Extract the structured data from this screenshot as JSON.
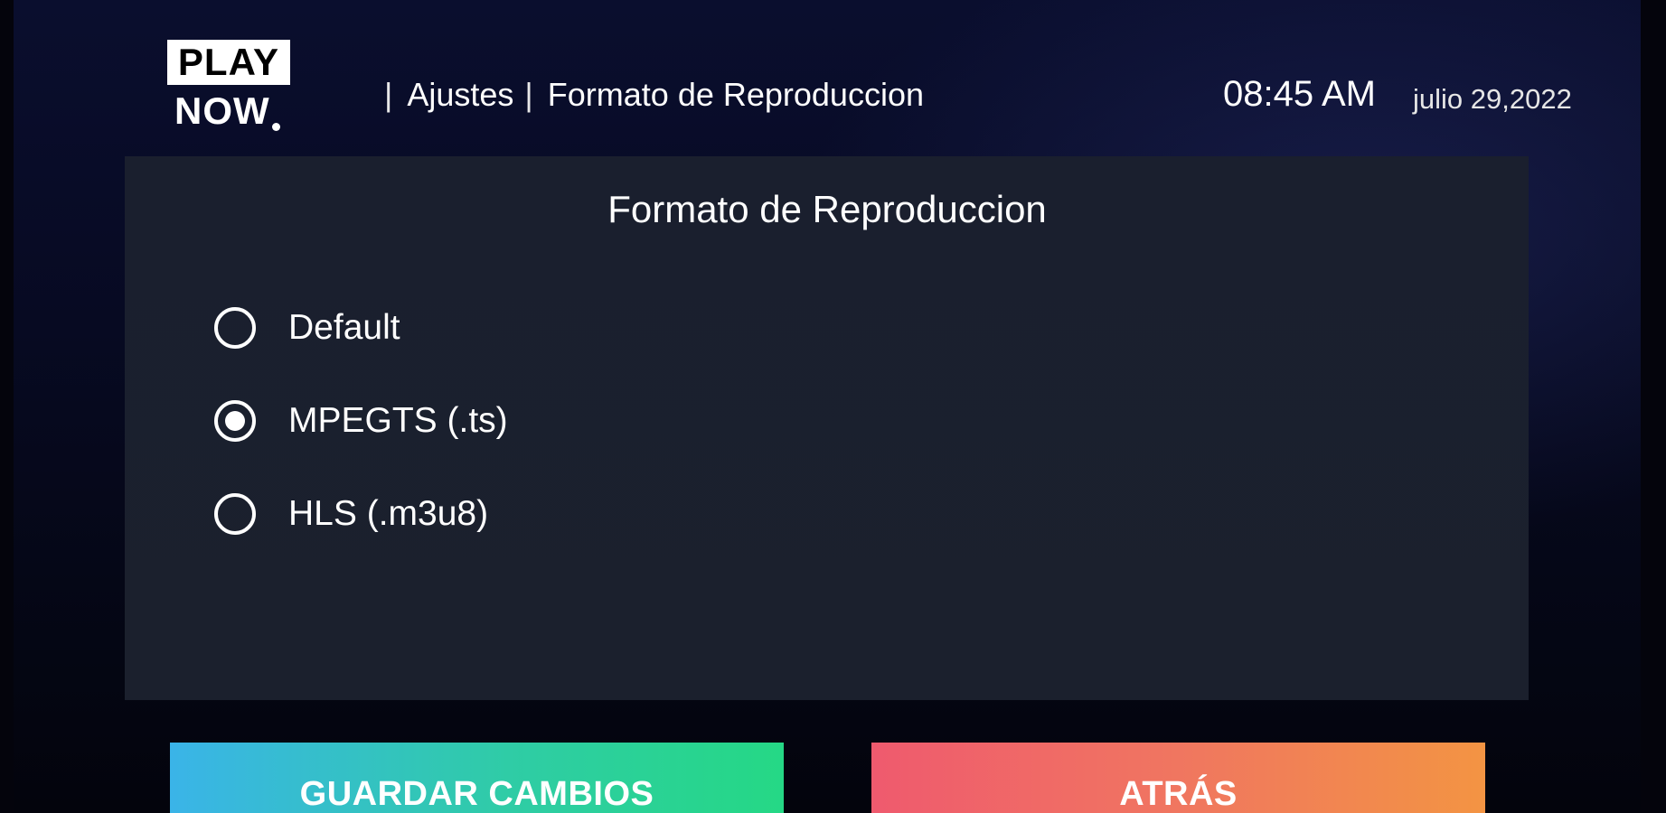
{
  "app": {
    "logo_top": "PLAY",
    "logo_bottom": "NOW"
  },
  "header": {
    "breadcrumb": [
      "Ajustes",
      "Formato de Reproduccion"
    ],
    "time": "08:45 AM",
    "date": "julio 29,2022"
  },
  "panel": {
    "title": "Formato de Reproduccion",
    "options": [
      {
        "label": "Default",
        "selected": false
      },
      {
        "label": "MPEGTS (.ts)",
        "selected": true
      },
      {
        "label": "HLS (.m3u8)",
        "selected": false
      }
    ]
  },
  "buttons": {
    "save_label": "GUARDAR CAMBIOS",
    "back_label": "ATRÁS"
  },
  "colors": {
    "save_gradient": [
      "#3ab4e8",
      "#25d885"
    ],
    "back_gradient": [
      "#ef5a6e",
      "#f39443"
    ],
    "panel_bg": "#1a1f2e"
  },
  "icons": {
    "radio_unselected": "radio-unchecked-icon",
    "radio_selected": "radio-checked-icon"
  }
}
